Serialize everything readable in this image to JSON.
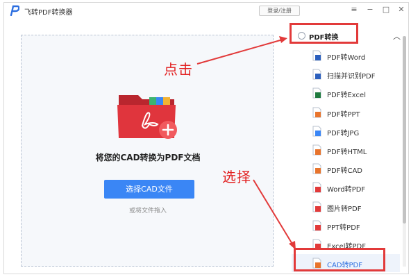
{
  "app": {
    "title": "飞转PDF转换器",
    "login_label": "登录/注册",
    "window_controls": [
      "menu-icon",
      "minimize-icon",
      "maximize-icon",
      "close-icon"
    ]
  },
  "dropzone": {
    "title": "将您的CAD转换为PDF文档",
    "button_label": "选择CAD文件",
    "hint": "或将文件拖入"
  },
  "sidebar": {
    "header_label": "PDF转换",
    "items": [
      {
        "label": "PDF转Word",
        "icon": "word-file-icon",
        "color": "#2b5fbd"
      },
      {
        "label": "扫描并识别PDF",
        "icon": "word-file-icon",
        "color": "#2b5fbd"
      },
      {
        "label": "PDF转Excel",
        "icon": "excel-file-icon",
        "color": "#1f7a3f"
      },
      {
        "label": "PDF转PPT",
        "icon": "ppt-file-icon",
        "color": "#e8742c"
      },
      {
        "label": "PDF转JPG",
        "icon": "image-file-icon",
        "color": "#3a86f5"
      },
      {
        "label": "PDF转HTML",
        "icon": "html-file-icon",
        "color": "#e8742c"
      },
      {
        "label": "PDF转CAD",
        "icon": "cad-file-icon",
        "color": "#e8742c"
      },
      {
        "label": "Word转PDF",
        "icon": "pdf-file-icon",
        "color": "#e23a3a"
      },
      {
        "label": "图片转PDF",
        "icon": "pdf-file-icon",
        "color": "#e23a3a"
      },
      {
        "label": "PPT转PDF",
        "icon": "pdf-file-icon",
        "color": "#e23a3a"
      },
      {
        "label": "Excel转PDF",
        "icon": "pdf-file-icon",
        "color": "#e23a3a"
      },
      {
        "label": "CAD转PDF",
        "icon": "pdf-file-icon",
        "color": "#e8742c",
        "selected": true
      }
    ]
  },
  "annotations": {
    "click_label": "点击",
    "select_label": "选择",
    "color": "#e22020"
  },
  "colors": {
    "accent": "#3a86f5",
    "folder": "#e0353d",
    "annotation": "#e23a3a"
  }
}
